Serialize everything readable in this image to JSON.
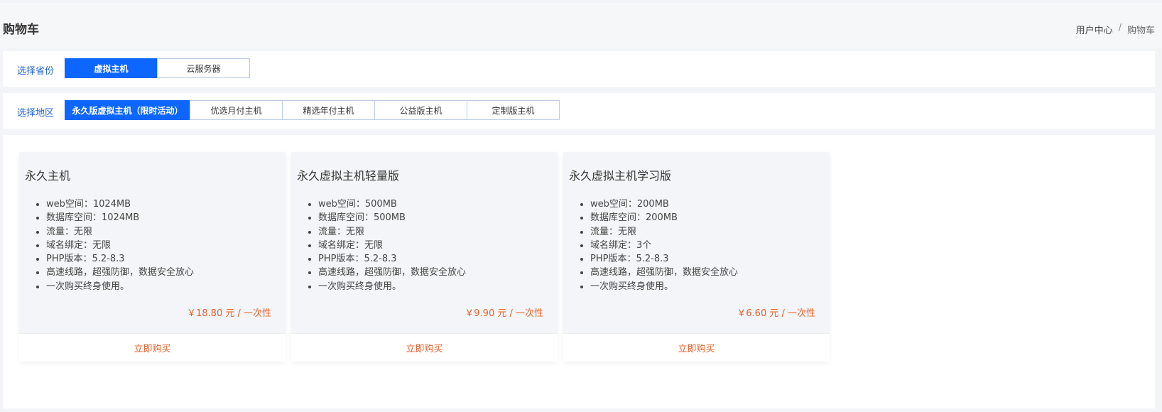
{
  "header": {
    "title": "购物车",
    "breadcrumb": [
      "用户中心",
      "购物车"
    ],
    "separator": "/"
  },
  "province_filter": {
    "label": "选择省份",
    "tabs": [
      {
        "label": "虚拟主机",
        "active": true
      },
      {
        "label": "云服务器",
        "active": false
      }
    ]
  },
  "region_filter": {
    "label": "选择地区",
    "tabs": [
      {
        "label": "永久版虚拟主机（限时活动）",
        "active": true
      },
      {
        "label": "优选月付主机",
        "active": false
      },
      {
        "label": "精选年付主机",
        "active": false
      },
      {
        "label": "公益版主机",
        "active": false
      },
      {
        "label": "定制版主机",
        "active": false
      }
    ]
  },
  "products": [
    {
      "title": "永久主机",
      "features": [
        "web空间：1024MB",
        "数据库空间：1024MB",
        "流量：无限",
        "域名绑定：无限",
        "PHP版本：5.2-8.3",
        "高速线路，超强防御，数据安全放心",
        "一次购买终身使用。"
      ],
      "price": "￥18.80 元 / 一次性",
      "buy_label": "立即购买"
    },
    {
      "title": "永久虚拟主机轻量版",
      "features": [
        "web空间：500MB",
        "数据库空间：500MB",
        "流量：无限",
        "域名绑定：无限",
        "PHP版本：5.2-8.3",
        "高速线路，超强防御，数据安全放心",
        "一次购买终身使用。"
      ],
      "price": "￥9.90 元 / 一次性",
      "buy_label": "立即购买"
    },
    {
      "title": "永久虚拟主机学习版",
      "features": [
        "web空间：200MB",
        "数据库空间：200MB",
        "流量：无限",
        "域名绑定：3个",
        "PHP版本：5.2-8.3",
        "高速线路，超强防御，数据安全放心",
        "一次购买终身使用。"
      ],
      "price": "￥6.60 元 / 一次性",
      "buy_label": "立即购买"
    }
  ],
  "colors": {
    "accent": "#0d66ff",
    "price": "#e8612b",
    "label": "#1e64d8"
  }
}
